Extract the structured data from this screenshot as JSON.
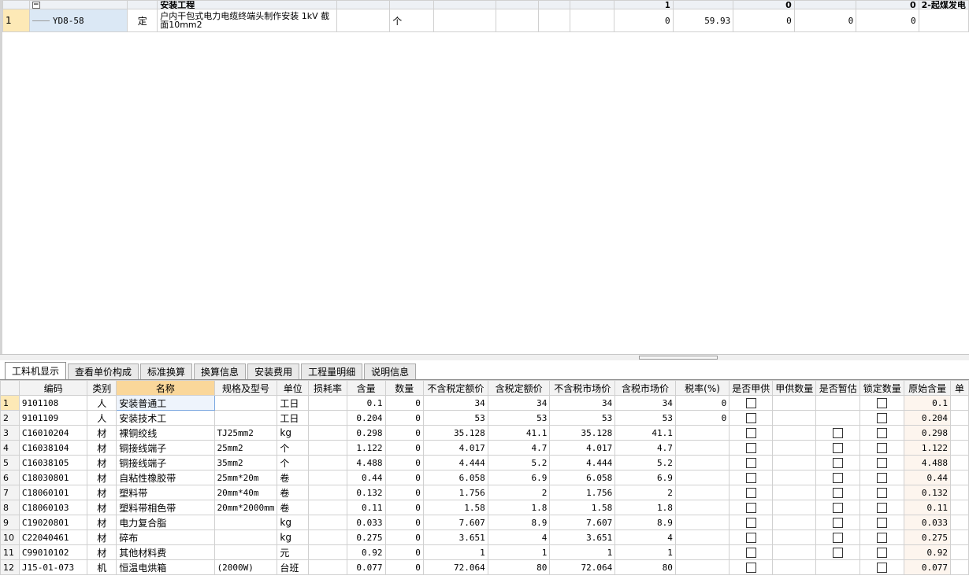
{
  "top": {
    "group_row": {
      "toggle": "−",
      "name": "安装工程",
      "qty": "1",
      "v1": "0",
      "v2": "0",
      "note": "2-起煤发电"
    },
    "rows": [
      {
        "num": "1",
        "code": "YD8-58",
        "type": "定",
        "name": "户内干包式电力电缆终端头制作安装 1kV 截面10mm2",
        "unit": "个",
        "qty": "0",
        "price": "59.93",
        "c1": "0",
        "c2": "0",
        "c3": "0"
      }
    ]
  },
  "tabs": [
    "工料机显示",
    "查看单价构成",
    "标准换算",
    "换算信息",
    "安装费用",
    "工程量明细",
    "说明信息"
  ],
  "bottom": {
    "headers": [
      "",
      "编码",
      "类别",
      "名称",
      "规格及型号",
      "单位",
      "损耗率",
      "含量",
      "数量",
      "不含税定额价",
      "含税定额价",
      "不含税市场价",
      "含税市场价",
      "税率(%)",
      "是否甲供",
      "甲供数量",
      "是否暂估",
      "锁定数量",
      "原始含量",
      "单"
    ],
    "rows": [
      {
        "n": "1",
        "code": "9101108",
        "cat": "人",
        "name": "安装普通工",
        "spec": "",
        "unit": "工日",
        "loss": "",
        "content": "0.1",
        "qty": "0",
        "p1": "34",
        "p2": "34",
        "p3": "34",
        "p4": "34",
        "tax": "0",
        "jg": true,
        "zg": false,
        "lock": true,
        "orig": "0.1"
      },
      {
        "n": "2",
        "code": "9101109",
        "cat": "人",
        "name": "安装技术工",
        "spec": "",
        "unit": "工日",
        "loss": "",
        "content": "0.204",
        "qty": "0",
        "p1": "53",
        "p2": "53",
        "p3": "53",
        "p4": "53",
        "tax": "0",
        "jg": true,
        "zg": false,
        "lock": true,
        "orig": "0.204"
      },
      {
        "n": "3",
        "code": "C16010204",
        "cat": "材",
        "name": "裸铜绞线",
        "spec": "TJ25mm2",
        "unit": "kg",
        "loss": "",
        "content": "0.298",
        "qty": "0",
        "p1": "35.128",
        "p2": "41.1",
        "p3": "35.128",
        "p4": "41.1",
        "tax": "",
        "jg": true,
        "zg": true,
        "lock": true,
        "orig": "0.298"
      },
      {
        "n": "4",
        "code": "C16038104",
        "cat": "材",
        "name": "铜接线端子",
        "spec": "25mm2",
        "unit": "个",
        "loss": "",
        "content": "1.122",
        "qty": "0",
        "p1": "4.017",
        "p2": "4.7",
        "p3": "4.017",
        "p4": "4.7",
        "tax": "",
        "jg": true,
        "zg": true,
        "lock": true,
        "orig": "1.122"
      },
      {
        "n": "5",
        "code": "C16038105",
        "cat": "材",
        "name": "铜接线端子",
        "spec": "35mm2",
        "unit": "个",
        "loss": "",
        "content": "4.488",
        "qty": "0",
        "p1": "4.444",
        "p2": "5.2",
        "p3": "4.444",
        "p4": "5.2",
        "tax": "",
        "jg": true,
        "zg": true,
        "lock": true,
        "orig": "4.488"
      },
      {
        "n": "6",
        "code": "C18030801",
        "cat": "材",
        "name": "自粘性橡胶带",
        "spec": "25mm*20m",
        "unit": "卷",
        "loss": "",
        "content": "0.44",
        "qty": "0",
        "p1": "6.058",
        "p2": "6.9",
        "p3": "6.058",
        "p4": "6.9",
        "tax": "",
        "jg": true,
        "zg": true,
        "lock": true,
        "orig": "0.44"
      },
      {
        "n": "7",
        "code": "C18060101",
        "cat": "材",
        "name": "塑料带",
        "spec": "20mm*40m",
        "unit": "卷",
        "loss": "",
        "content": "0.132",
        "qty": "0",
        "p1": "1.756",
        "p2": "2",
        "p3": "1.756",
        "p4": "2",
        "tax": "",
        "jg": true,
        "zg": true,
        "lock": true,
        "orig": "0.132"
      },
      {
        "n": "8",
        "code": "C18060103",
        "cat": "材",
        "name": "塑料带相色带",
        "spec": "20mm*2000mm",
        "unit": "卷",
        "loss": "",
        "content": "0.11",
        "qty": "0",
        "p1": "1.58",
        "p2": "1.8",
        "p3": "1.58",
        "p4": "1.8",
        "tax": "",
        "jg": true,
        "zg": true,
        "lock": true,
        "orig": "0.11"
      },
      {
        "n": "9",
        "code": "C19020801",
        "cat": "材",
        "name": "电力复合脂",
        "spec": "",
        "unit": "kg",
        "loss": "",
        "content": "0.033",
        "qty": "0",
        "p1": "7.607",
        "p2": "8.9",
        "p3": "7.607",
        "p4": "8.9",
        "tax": "",
        "jg": true,
        "zg": true,
        "lock": true,
        "orig": "0.033"
      },
      {
        "n": "10",
        "code": "C22040461",
        "cat": "材",
        "name": "碎布",
        "spec": "",
        "unit": "kg",
        "loss": "",
        "content": "0.275",
        "qty": "0",
        "p1": "3.651",
        "p2": "4",
        "p3": "3.651",
        "p4": "4",
        "tax": "",
        "jg": true,
        "zg": true,
        "lock": true,
        "orig": "0.275"
      },
      {
        "n": "11",
        "code": "C99010102",
        "cat": "材",
        "name": "其他材料费",
        "spec": "",
        "unit": "元",
        "loss": "",
        "content": "0.92",
        "qty": "0",
        "p1": "1",
        "p2": "1",
        "p3": "1",
        "p4": "1",
        "tax": "",
        "jg": true,
        "zg": true,
        "lock": true,
        "orig": "0.92"
      },
      {
        "n": "12",
        "code": "J15-01-073",
        "cat": "机",
        "name": "恒温电烘箱",
        "spec": "(2000W)",
        "unit": "台班",
        "loss": "",
        "content": "0.077",
        "qty": "0",
        "p1": "72.064",
        "p2": "80",
        "p3": "72.064",
        "p4": "80",
        "tax": "",
        "jg": true,
        "zg": false,
        "lock": true,
        "orig": "0.077"
      }
    ]
  }
}
